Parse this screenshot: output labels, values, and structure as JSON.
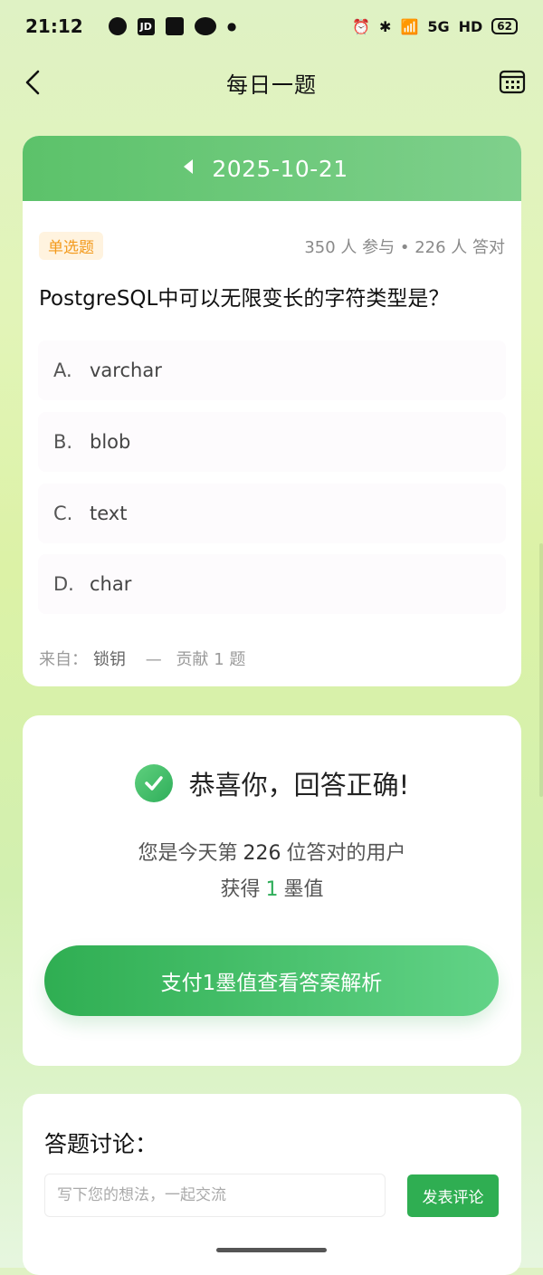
{
  "status_bar": {
    "time": "21:12",
    "network": "HD",
    "battery": "62",
    "signal": "5G"
  },
  "nav": {
    "title": "每日一题"
  },
  "question": {
    "date": "2025-10-21",
    "type": "单选题",
    "stats": "350 人 参与 • 226 人 答对",
    "text": "PostgreSQL中可以无限变长的字符类型是？",
    "options": [
      {
        "letter": "A.",
        "value": "varchar"
      },
      {
        "letter": "B.",
        "value": "blob"
      },
      {
        "letter": "C.",
        "value": "text"
      },
      {
        "letter": "D.",
        "value": "char"
      }
    ],
    "source_label": "来自：",
    "source_author": "锁钥",
    "source_sep": "—",
    "source_contrib": "贡献 1 题"
  },
  "result": {
    "title": "恭喜你，回答正确!",
    "line1_pre": "您是今天第",
    "line1_num": "226",
    "line1_post": "位答对的用户",
    "line2_pre": "获得",
    "line2_num": "1",
    "line2_post": "墨值",
    "pay_button": "支付1墨值查看答案解析"
  },
  "discussion": {
    "title": "答题讨论：",
    "placeholder": "写下您的想法，一起交流",
    "submit": "发表评论"
  },
  "colors": {
    "accent": "#2fae52",
    "header_green": "#5cc26a",
    "type_badge": "#f39a1c"
  },
  "icons": [
    "back-arrow-icon",
    "calendar-icon",
    "prev-date-icon",
    "check-circle-icon"
  ]
}
